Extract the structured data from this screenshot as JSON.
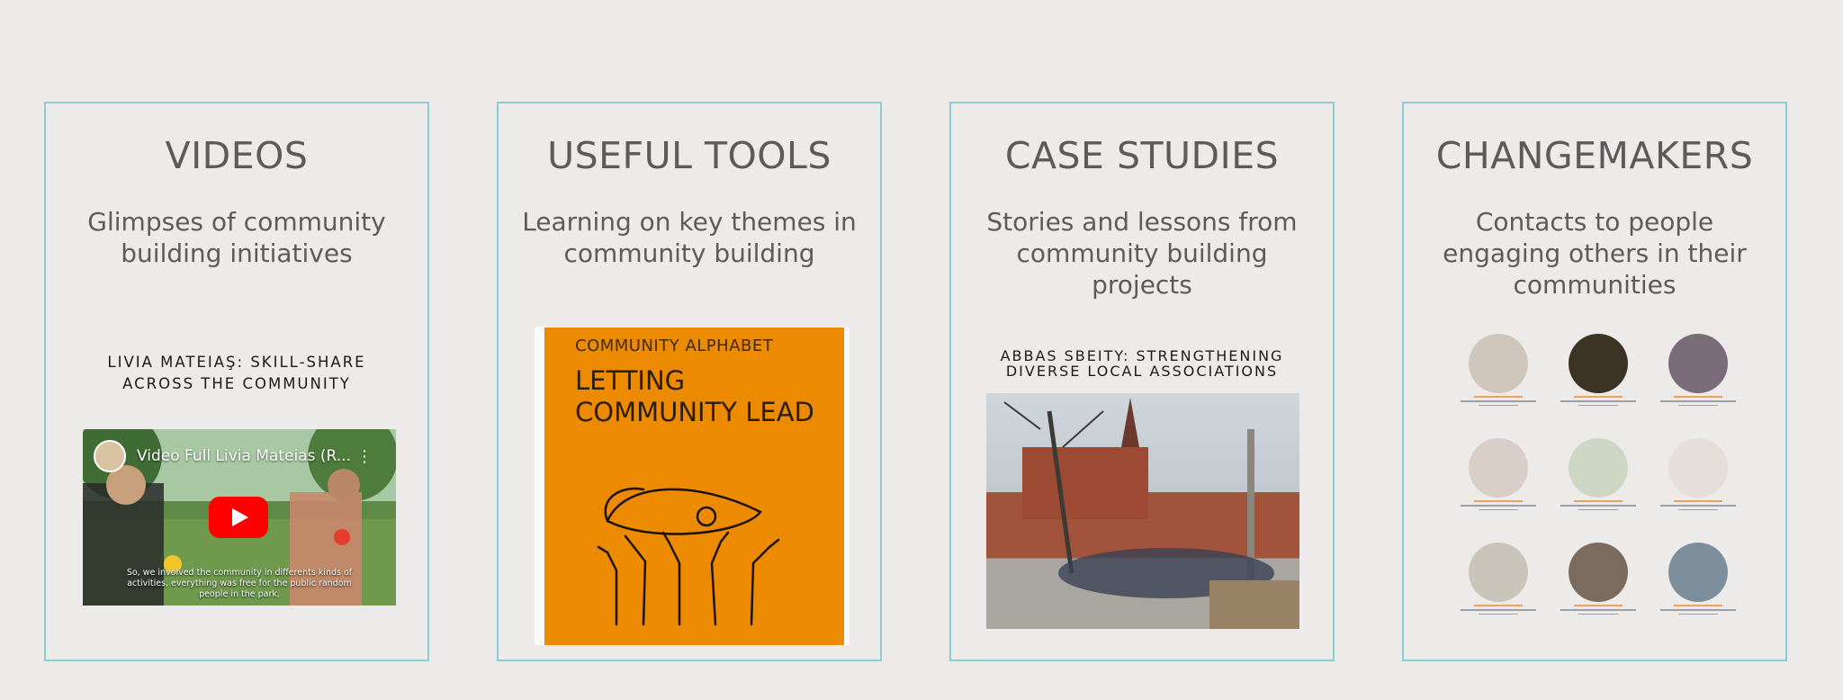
{
  "cards": [
    {
      "title": "VIDEOS",
      "subtitle": "Glimpses of community building initiatives"
    },
    {
      "title": "USEFUL TOOLS",
      "subtitle": "Learning on key themes in community building"
    },
    {
      "title": "CASE STUDIES",
      "subtitle": "Stories and lessons from community building projects"
    },
    {
      "title": "CHANGEMAKERS",
      "subtitle": "Contacts to people engaging others in their communities"
    }
  ],
  "video": {
    "caption": "LIVIA MATEIAŞ: SKILL-SHARE ACROSS THE COMMUNITY",
    "player_title": "Video Full Livia Mateias (R...",
    "subtitle_text": "So, we involved the community in differents kinds of activities, everything was free for the public random people in the park,"
  },
  "tool": {
    "series": "COMMUNITY ALPHABET",
    "title": "LETTING COMMUNITY LEAD"
  },
  "case": {
    "caption": "ABBAS SBEITY: STRENGTHENING DIVERSE LOCAL ASSOCIATIONS"
  },
  "colors": {
    "background": "#edebea",
    "card_border": "#8ccdd3",
    "heading_text": "#5b5b5b",
    "book_orange": "#ec8a02",
    "play_red": "#ff0000",
    "accent_orange": "#e9a45a"
  },
  "icons": {
    "play": "youtube-play-icon",
    "menu": "vertical-dots-icon"
  }
}
